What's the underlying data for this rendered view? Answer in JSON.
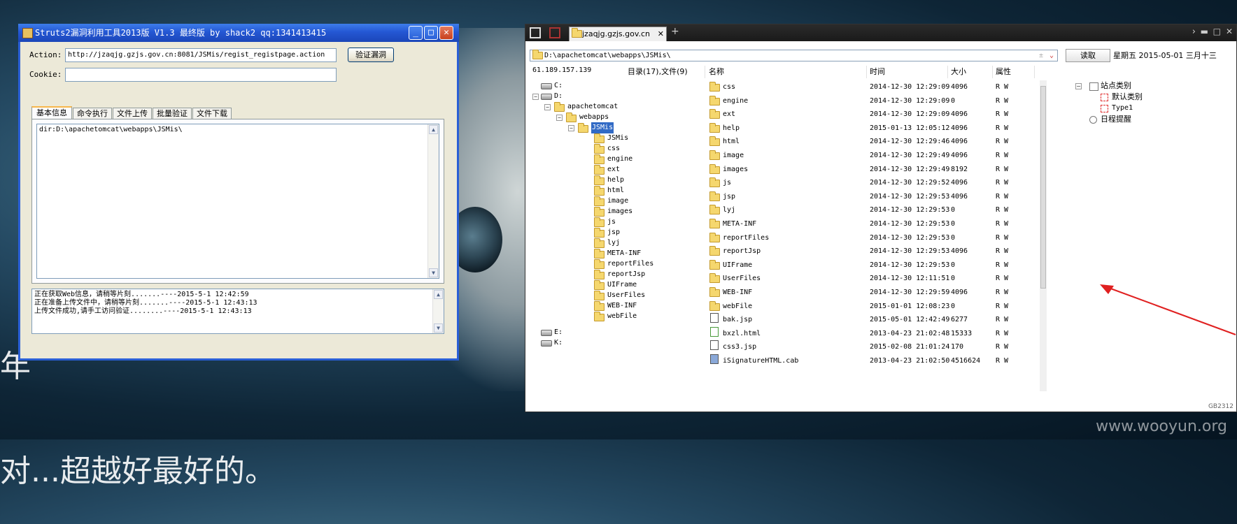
{
  "wallpaper": {
    "text_lines": [
      "年",
      "对...超越好最好的。"
    ],
    "watermark": "www.wooyun.org"
  },
  "struts_window": {
    "title": "Struts2漏洞利用工具2013版 V1.3 最终版 by shack2 qq:1341413415",
    "action_label": "Action:",
    "action_value": "http://jzaqjg.gzjs.gov.cn:8081/JSMis/regist_registpage.action",
    "cookie_label": "Cookie:",
    "cookie_value": "",
    "verify_button": "验证漏洞",
    "tabs": [
      {
        "label": "基本信息",
        "active": true
      },
      {
        "label": "命令执行",
        "active": false
      },
      {
        "label": "文件上传",
        "active": false
      },
      {
        "label": "批量验证",
        "active": false
      },
      {
        "label": "文件下载",
        "active": false
      }
    ],
    "output_text": "dir:D:\\apachetomcat\\webapps\\JSMis\\",
    "log_lines": [
      "正在获取Web信息，请稍等片刻.......----2015-5-1 12:42:59",
      "正在准备上传文件中，请稍等片刻.......----2015-5-1 12:43:13",
      "上传文件成功,请手工访问验证........----2015-5-1 12:43:13"
    ]
  },
  "file_manager": {
    "tab_title": "jzaqjg.gzjs.gov.cn",
    "new_tab": "+",
    "path": "D:\\apachetomcat\\webapps\\JSMis\\",
    "read_button": "读取",
    "date_text": "星期五 2015-05-01 三月十三",
    "ip": "61.189.157.139",
    "summary": "目录(17),文件(9)",
    "columns": {
      "name": "名称",
      "time": "时间",
      "size": "大小",
      "attr": "属性"
    },
    "tree": [
      {
        "label": "C:",
        "type": "drive",
        "level": 0
      },
      {
        "label": "D:",
        "type": "drive",
        "level": 0,
        "expanded": true
      },
      {
        "label": "apachetomcat",
        "type": "folder",
        "level": 1,
        "expanded": true
      },
      {
        "label": "webapps",
        "type": "folder",
        "level": 2,
        "expanded": true
      },
      {
        "label": "JSMis",
        "type": "folder",
        "level": 3,
        "expanded": true,
        "selected": true
      },
      {
        "label": "JSMis",
        "type": "folder",
        "level": 4
      },
      {
        "label": "css",
        "type": "folder",
        "level": 4
      },
      {
        "label": "engine",
        "type": "folder",
        "level": 4
      },
      {
        "label": "ext",
        "type": "folder",
        "level": 4
      },
      {
        "label": "help",
        "type": "folder",
        "level": 4
      },
      {
        "label": "html",
        "type": "folder",
        "level": 4
      },
      {
        "label": "image",
        "type": "folder",
        "level": 4
      },
      {
        "label": "images",
        "type": "folder",
        "level": 4
      },
      {
        "label": "js",
        "type": "folder",
        "level": 4
      },
      {
        "label": "jsp",
        "type": "folder",
        "level": 4
      },
      {
        "label": "lyj",
        "type": "folder",
        "level": 4
      },
      {
        "label": "META-INF",
        "type": "folder",
        "level": 4
      },
      {
        "label": "reportFiles",
        "type": "folder",
        "level": 4
      },
      {
        "label": "reportJsp",
        "type": "folder",
        "level": 4
      },
      {
        "label": "UIFrame",
        "type": "folder",
        "level": 4
      },
      {
        "label": "UserFiles",
        "type": "folder",
        "level": 4
      },
      {
        "label": "WEB-INF",
        "type": "folder",
        "level": 4
      },
      {
        "label": "webFile",
        "type": "folder",
        "level": 4
      },
      {
        "label": "E:",
        "type": "drive",
        "level": 0,
        "gap": true
      },
      {
        "label": "K:",
        "type": "drive",
        "level": 0
      }
    ],
    "files": [
      {
        "name": "css",
        "time": "2014-12-30 12:29:09",
        "size": "4096",
        "attr": "R W",
        "type": "folder"
      },
      {
        "name": "engine",
        "time": "2014-12-30 12:29:09",
        "size": "0",
        "attr": "R W",
        "type": "folder"
      },
      {
        "name": "ext",
        "time": "2014-12-30 12:29:09",
        "size": "4096",
        "attr": "R W",
        "type": "folder"
      },
      {
        "name": "help",
        "time": "2015-01-13 12:05:12",
        "size": "4096",
        "attr": "R W",
        "type": "folder"
      },
      {
        "name": "html",
        "time": "2014-12-30 12:29:46",
        "size": "4096",
        "attr": "R W",
        "type": "folder"
      },
      {
        "name": "image",
        "time": "2014-12-30 12:29:49",
        "size": "4096",
        "attr": "R W",
        "type": "folder"
      },
      {
        "name": "images",
        "time": "2014-12-30 12:29:49",
        "size": "8192",
        "attr": "R W",
        "type": "folder"
      },
      {
        "name": "js",
        "time": "2014-12-30 12:29:52",
        "size": "4096",
        "attr": "R W",
        "type": "folder"
      },
      {
        "name": "jsp",
        "time": "2014-12-30 12:29:53",
        "size": "4096",
        "attr": "R W",
        "type": "folder"
      },
      {
        "name": "lyj",
        "time": "2014-12-30 12:29:53",
        "size": "0",
        "attr": "R W",
        "type": "folder"
      },
      {
        "name": "META-INF",
        "time": "2014-12-30 12:29:53",
        "size": "0",
        "attr": "R W",
        "type": "folder"
      },
      {
        "name": "reportFiles",
        "time": "2014-12-30 12:29:53",
        "size": "0",
        "attr": "R W",
        "type": "folder"
      },
      {
        "name": "reportJsp",
        "time": "2014-12-30 12:29:53",
        "size": "4096",
        "attr": "R W",
        "type": "folder"
      },
      {
        "name": "UIFrame",
        "time": "2014-12-30 12:29:53",
        "size": "0",
        "attr": "R W",
        "type": "folder"
      },
      {
        "name": "UserFiles",
        "time": "2014-12-30 12:11:51",
        "size": "0",
        "attr": "R W",
        "type": "folder"
      },
      {
        "name": "WEB-INF",
        "time": "2014-12-30 12:29:59",
        "size": "4096",
        "attr": "R W",
        "type": "folder"
      },
      {
        "name": "webFile",
        "time": "2015-01-01 12:08:23",
        "size": "0",
        "attr": "R W",
        "type": "folder"
      },
      {
        "name": "bak.jsp",
        "time": "2015-05-01 12:42:49",
        "size": "6277",
        "attr": "R W",
        "type": "jsp"
      },
      {
        "name": "bxzl.html",
        "time": "2013-04-23 21:02:48",
        "size": "15333",
        "attr": "R W",
        "type": "html"
      },
      {
        "name": "css3.jsp",
        "time": "2015-02-08 21:01:24",
        "size": "170",
        "attr": "R W",
        "type": "jsp"
      },
      {
        "name": "iSignatureHTML.cab",
        "time": "2013-04-23 21:02:50",
        "size": "4516624",
        "attr": "R W",
        "type": "cab"
      }
    ],
    "sidebar": [
      {
        "label": "站点类别",
        "level": 0,
        "icon": "expander"
      },
      {
        "label": "默认类别",
        "level": 1,
        "icon": "redbox"
      },
      {
        "label": "Type1",
        "level": 1,
        "icon": "redbox"
      },
      {
        "label": "日程提醒",
        "level": 0,
        "icon": "clock"
      }
    ],
    "encoding": "GB2312"
  },
  "colors": {
    "xp_title": "#2457d4",
    "arrow": "#e02020",
    "selection": "#316ac5"
  }
}
